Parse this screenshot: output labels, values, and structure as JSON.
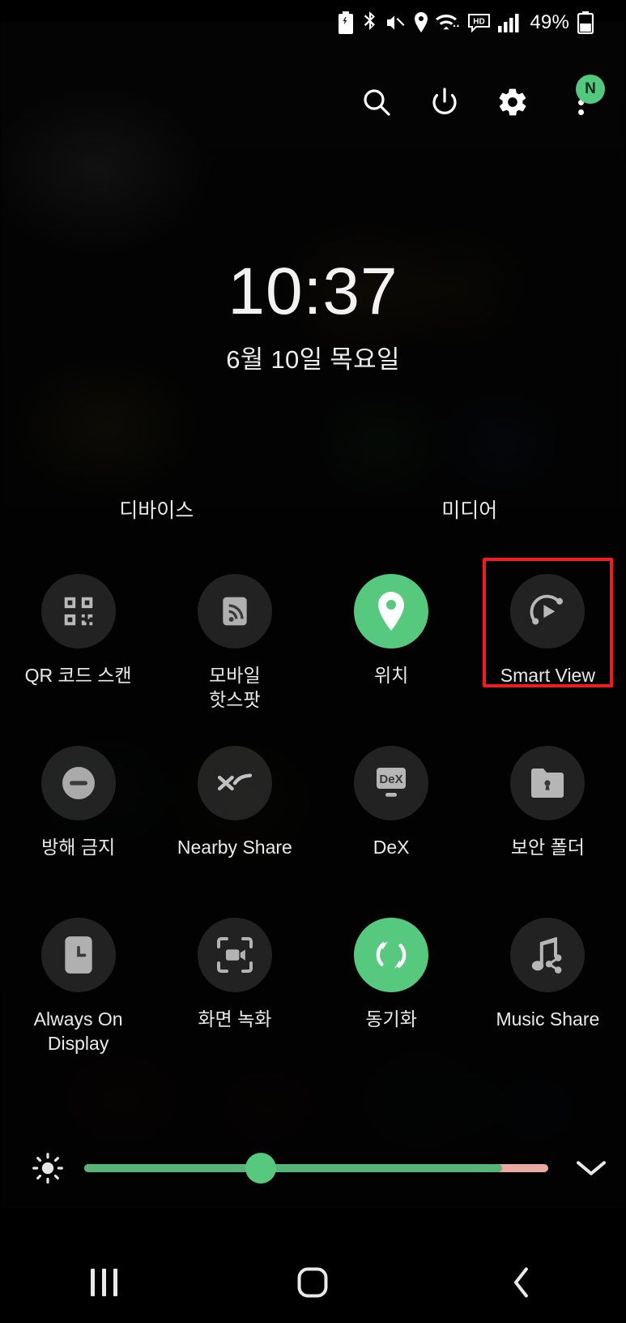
{
  "statusbar": {
    "icons": [
      "battery-saver-icon",
      "bluetooth-icon",
      "mute-icon",
      "location-icon",
      "wifi-icon",
      "hd-call-icon",
      "signal-bars-icon"
    ],
    "battery_percent": "49%",
    "battery_icon": "battery-icon"
  },
  "header": {
    "search_label": "search-icon",
    "power_label": "power-icon",
    "settings_label": "gear-icon",
    "more_label": "more-options-icon",
    "badge_text": "N"
  },
  "clock": {
    "time": "10:37",
    "date": "6월 10일 목요일"
  },
  "sections": {
    "devices_label": "디바이스",
    "media_label": "미디어"
  },
  "tiles": [
    [
      {
        "label": "QR 코드 스캔",
        "icon": "qr-code-icon",
        "active": false,
        "highlighted": false
      },
      {
        "label": "모바일\n핫스팟",
        "icon": "mobile-hotspot-icon",
        "active": false,
        "highlighted": false
      },
      {
        "label": "위치",
        "icon": "location-pin-icon",
        "active": true,
        "highlighted": false
      },
      {
        "label": "Smart View",
        "icon": "smart-view-icon",
        "active": false,
        "highlighted": true
      }
    ],
    [
      {
        "label": "방해 금지",
        "icon": "do-not-disturb-icon",
        "active": false,
        "highlighted": false
      },
      {
        "label": "Nearby Share",
        "icon": "nearby-share-icon",
        "active": false,
        "highlighted": false
      },
      {
        "label": "DeX",
        "icon": "dex-icon",
        "active": false,
        "highlighted": false
      },
      {
        "label": "보안 폴더",
        "icon": "secure-folder-icon",
        "active": false,
        "highlighted": false
      }
    ],
    [
      {
        "label": "Always On\nDisplay",
        "icon": "always-on-display-icon",
        "active": false,
        "highlighted": false
      },
      {
        "label": "화면 녹화",
        "icon": "screen-recorder-icon",
        "active": false,
        "highlighted": false
      },
      {
        "label": "동기화",
        "icon": "sync-icon",
        "active": true,
        "highlighted": false
      },
      {
        "label": "Music Share",
        "icon": "music-share-icon",
        "active": false,
        "highlighted": false
      }
    ]
  ],
  "brightness": {
    "icon": "brightness-icon",
    "value_percent": 38,
    "fill_percent": 90,
    "expand_icon": "chevron-down-icon",
    "track_color": "#eaa9a3",
    "fill_color": "#57b377",
    "thumb_color": "#57c97f"
  },
  "navbar": {
    "recents_label": "recents-button",
    "home_label": "home-button",
    "back_label": "back-button"
  },
  "colors": {
    "accent_green": "#57c97f",
    "highlight_red": "#f01b24",
    "tile_inactive": "rgba(126,126,126,.26)"
  }
}
